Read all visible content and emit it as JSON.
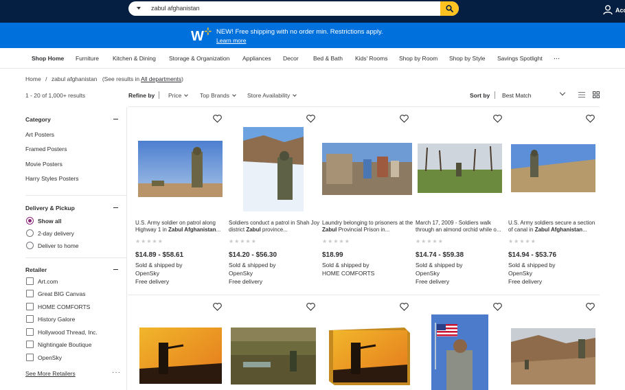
{
  "header": {
    "search_value": "zabul afghanistan",
    "account_label": "Account"
  },
  "banner": {
    "message": "NEW! Free shipping with no order min. Restrictions apply.",
    "link": "Learn more"
  },
  "nav": [
    "Shop Home",
    "Furniture",
    "Kitchen & Dining",
    "Storage & Organization",
    "Appliances",
    "Decor",
    "Bed & Bath",
    "Kids' Rooms",
    "Shop by Room",
    "Shop by Style",
    "Savings Spotlight",
    "..."
  ],
  "breadcrumb": {
    "home": "Home",
    "sep": "/",
    "current": "zabul afghanistan",
    "see_prefix": "(See results in",
    "see_link": "All departments",
    "see_suffix": ")"
  },
  "results": {
    "count": "1 - 20 of 1,000+ results",
    "refine_label": "Refine by",
    "filters": [
      "Price",
      "Top Brands",
      "Store Availability"
    ],
    "sort_label": "Sort by",
    "sort_value": "Best Match"
  },
  "sidebar": {
    "category_title": "Category",
    "categories": [
      "Art Posters",
      "Framed Posters",
      "Movie Posters",
      "Harry Styles Posters"
    ],
    "delivery_title": "Delivery & Pickup",
    "delivery_options": [
      "Show all",
      "2-day delivery",
      "Deliver to home"
    ],
    "retailer_title": "Retailer",
    "retailers": [
      "Art.com",
      "Great BIG Canvas",
      "HOME COMFORTS",
      "History Galore",
      "Hollywood Thread, Inc.",
      "Nightingale Boutique",
      "OpenSky"
    ],
    "see_more": "See More Retailers",
    "more_dots": "···"
  },
  "products": [
    {
      "title_pre": "U.S. Army soldier on patrol along Highway 1 in ",
      "title_bold": "Zabul Afghanistan",
      "title_post": "...",
      "stars": "★★★★★",
      "price": "$14.89 - $58.61",
      "sold_by": "Sold & shipped by",
      "seller": "OpenSky",
      "delivery": "Free delivery"
    },
    {
      "title_pre": "Soldiers conduct a patrol in Shah Joy district ",
      "title_bold": "Zabul",
      "title_post": " province...",
      "stars": "★★★★★",
      "price": "$14.20 - $56.30",
      "sold_by": "Sold & shipped by",
      "seller": "OpenSky",
      "delivery": "Free delivery"
    },
    {
      "title_pre": "Laundry belonging to prisoners at the ",
      "title_bold": "Zabul",
      "title_post": " Provincial Prison in...",
      "stars": "★★★★★",
      "price": "$18.99",
      "sold_by": "Sold & shipped by",
      "seller": "HOME COMFORTS",
      "delivery": ""
    },
    {
      "title_pre": "March 17, 2009 - Soldiers walk through an almond orchid while o...",
      "title_bold": "",
      "title_post": "",
      "stars": "★★★★★",
      "price": "$14.74 - $59.38",
      "sold_by": "Sold & shipped by",
      "seller": "OpenSky",
      "delivery": "Free delivery"
    },
    {
      "title_pre": "U.S. Army soldiers secure a section of canal in ",
      "title_bold": "Zabul Afghanistan",
      "title_post": "...",
      "stars": "★★★★★",
      "price": "$14.94 - $53.76",
      "sold_by": "Sold & shipped by",
      "seller": "OpenSky",
      "delivery": "Free delivery"
    }
  ],
  "colors": {
    "header_bg": "#041f41",
    "banner_bg": "#0071dc",
    "search_button": "#ffc220",
    "radio_selected": "#8a2279"
  }
}
